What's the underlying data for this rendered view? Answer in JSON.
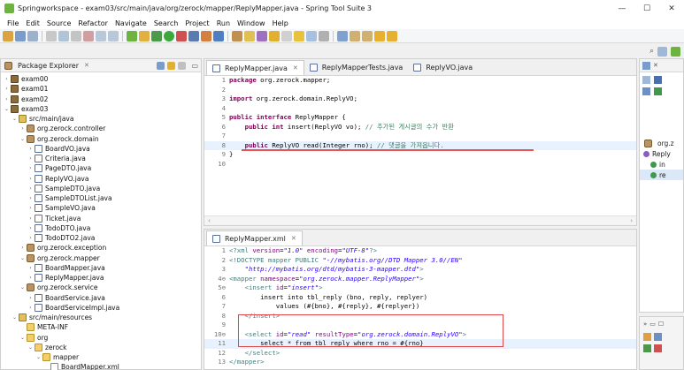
{
  "window": {
    "title": "Springworkspace - exam03/src/main/java/org/zerock/mapper/ReplyMapper.java - Spring Tool Suite 3",
    "controls": [
      "—",
      "☐",
      "✕"
    ]
  },
  "menu": [
    "File",
    "Edit",
    "Source",
    "Refactor",
    "Navigate",
    "Search",
    "Project",
    "Run",
    "Window",
    "Help"
  ],
  "package_explorer": {
    "title": "Package Explorer",
    "close_glyph": "✕",
    "items": [
      {
        "label": "exam00",
        "indent": 0,
        "icon": "project",
        "twisty": "›"
      },
      {
        "label": "exam01",
        "indent": 0,
        "icon": "project",
        "twisty": "›"
      },
      {
        "label": "exam02",
        "indent": 0,
        "icon": "project",
        "twisty": "›"
      },
      {
        "label": "exam03",
        "indent": 0,
        "icon": "project",
        "twisty": "⌄"
      },
      {
        "label": "src/main/java",
        "indent": 1,
        "icon": "srcfolder",
        "twisty": "⌄"
      },
      {
        "label": "org.zerock.controller",
        "indent": 2,
        "icon": "package",
        "twisty": "›"
      },
      {
        "label": "org.zerock.domain",
        "indent": 2,
        "icon": "package",
        "twisty": "⌄"
      },
      {
        "label": "BoardVO.java",
        "indent": 3,
        "icon": "java",
        "twisty": "›"
      },
      {
        "label": "Criteria.java",
        "indent": 3,
        "icon": "java",
        "twisty": "›"
      },
      {
        "label": "PageDTO.java",
        "indent": 3,
        "icon": "java",
        "twisty": "›"
      },
      {
        "label": "ReplyVO.java",
        "indent": 3,
        "icon": "java",
        "twisty": "›"
      },
      {
        "label": "SampleDTO.java",
        "indent": 3,
        "icon": "java",
        "twisty": "›"
      },
      {
        "label": "SampleDTOList.java",
        "indent": 3,
        "icon": "java",
        "twisty": "›"
      },
      {
        "label": "SampleVO.java",
        "indent": 3,
        "icon": "java",
        "twisty": "›"
      },
      {
        "label": "Ticket.java",
        "indent": 3,
        "icon": "java",
        "twisty": "›"
      },
      {
        "label": "TodoDTO.java",
        "indent": 3,
        "icon": "java",
        "twisty": "›"
      },
      {
        "label": "TodoDTO2.java",
        "indent": 3,
        "icon": "java",
        "twisty": "›"
      },
      {
        "label": "org.zerock.exception",
        "indent": 2,
        "icon": "package",
        "twisty": "›"
      },
      {
        "label": "org.zerock.mapper",
        "indent": 2,
        "icon": "package",
        "twisty": "⌄"
      },
      {
        "label": "BoardMapper.java",
        "indent": 3,
        "icon": "java",
        "twisty": "›"
      },
      {
        "label": "ReplyMapper.java",
        "indent": 3,
        "icon": "java",
        "twisty": "›"
      },
      {
        "label": "org.zerock.service",
        "indent": 2,
        "icon": "package",
        "twisty": "⌄"
      },
      {
        "label": "BoardService.java",
        "indent": 3,
        "icon": "java",
        "twisty": "›"
      },
      {
        "label": "BoardServiceImpl.java",
        "indent": 3,
        "icon": "java",
        "twisty": "›"
      },
      {
        "label": "src/main/resources",
        "indent": 1,
        "icon": "srcfolder",
        "twisty": "⌄"
      },
      {
        "label": "META-INF",
        "indent": 2,
        "icon": "folder",
        "twisty": ""
      },
      {
        "label": "org",
        "indent": 2,
        "icon": "folder",
        "twisty": "⌄"
      },
      {
        "label": "zerock",
        "indent": 3,
        "icon": "folder",
        "twisty": "⌄"
      },
      {
        "label": "mapper",
        "indent": 4,
        "icon": "folder",
        "twisty": "⌄"
      },
      {
        "label": "BoardMapper.xml",
        "indent": 5,
        "icon": "xml",
        "twisty": ""
      }
    ]
  },
  "editor_top": {
    "tabs": [
      {
        "label": "ReplyMapper.java",
        "active": true,
        "close": "✕"
      },
      {
        "label": "ReplyMapperTests.java",
        "active": false,
        "close": ""
      },
      {
        "label": "ReplyVO.java",
        "active": false,
        "close": ""
      }
    ],
    "lines": [
      {
        "n": "1",
        "tokens": [
          {
            "c": "kw",
            "t": "package"
          },
          {
            "c": "plain",
            "t": " org.zerock.mapper;"
          }
        ]
      },
      {
        "n": "2",
        "tokens": []
      },
      {
        "n": "3",
        "tokens": [
          {
            "c": "kw",
            "t": "import"
          },
          {
            "c": "plain",
            "t": " org.zerock.domain.ReplyVO;"
          }
        ]
      },
      {
        "n": "4",
        "tokens": []
      },
      {
        "n": "5",
        "tokens": [
          {
            "c": "kw",
            "t": "public interface"
          },
          {
            "c": "plain",
            "t": " ReplyMapper {"
          }
        ]
      },
      {
        "n": "6",
        "tokens": [
          {
            "c": "plain",
            "t": "    "
          },
          {
            "c": "kw",
            "t": "public int"
          },
          {
            "c": "plain",
            "t": " insert(ReplyVO vo); "
          },
          {
            "c": "cm",
            "t": "// 추가된 게시글의 수가 반환"
          }
        ]
      },
      {
        "n": "7",
        "tokens": []
      },
      {
        "n": "8",
        "tokens": [
          {
            "c": "plain",
            "t": "    "
          },
          {
            "c": "kw",
            "t": "public"
          },
          {
            "c": "plain",
            "t": " ReplyVO read(Integer rno); "
          },
          {
            "c": "cm",
            "t": "// 댓글을 가져옵니다."
          }
        ],
        "current": true
      },
      {
        "n": "9",
        "tokens": [
          {
            "c": "plain",
            "t": "}"
          }
        ]
      },
      {
        "n": "10",
        "tokens": []
      }
    ]
  },
  "editor_bottom": {
    "tabs": [
      {
        "label": "ReplyMapper.xml",
        "active": true,
        "close": "✕"
      }
    ],
    "lines": [
      {
        "n": "1",
        "tokens": [
          {
            "c": "tag",
            "t": "<?xml "
          },
          {
            "c": "att",
            "t": "version"
          },
          {
            "c": "plain",
            "t": "="
          },
          {
            "c": "str",
            "t": "\"1.0\""
          },
          {
            "c": "plain",
            "t": " "
          },
          {
            "c": "att",
            "t": "encoding"
          },
          {
            "c": "plain",
            "t": "="
          },
          {
            "c": "str",
            "t": "\"UTF-8\""
          },
          {
            "c": "tag",
            "t": "?>"
          }
        ]
      },
      {
        "n": "2",
        "tokens": [
          {
            "c": "tag",
            "t": "<!DOCTYPE mapper PUBLIC "
          },
          {
            "c": "str",
            "t": "\"-//mybatis.org//DTD Mapper 3.0//EN\""
          }
        ]
      },
      {
        "n": "3",
        "tokens": [
          {
            "c": "str",
            "t": "    \"http://mybatis.org/dtd/mybatis-3-mapper.dtd\""
          },
          {
            "c": "tag",
            "t": ">"
          }
        ]
      },
      {
        "n": "4⊖",
        "tokens": [
          {
            "c": "tag",
            "t": "<mapper "
          },
          {
            "c": "att",
            "t": "namespace"
          },
          {
            "c": "plain",
            "t": "="
          },
          {
            "c": "str",
            "t": "\"org.zerock.mapper.ReplyMapper\""
          },
          {
            "c": "tag",
            "t": ">"
          }
        ]
      },
      {
        "n": "5⊖",
        "tokens": [
          {
            "c": "plain",
            "t": "    "
          },
          {
            "c": "tag",
            "t": "<insert "
          },
          {
            "c": "att",
            "t": "id"
          },
          {
            "c": "plain",
            "t": "="
          },
          {
            "c": "str",
            "t": "\"insert\""
          },
          {
            "c": "tag",
            "t": ">"
          }
        ]
      },
      {
        "n": "6",
        "tokens": [
          {
            "c": "plain",
            "t": "        insert into tbl_reply (bno, reply, replyer)"
          }
        ]
      },
      {
        "n": "7",
        "tokens": [
          {
            "c": "plain",
            "t": "            values (#{bno}, #{reply}, #{replyer})"
          }
        ]
      },
      {
        "n": "8",
        "tokens": [
          {
            "c": "plain",
            "t": "    "
          },
          {
            "c": "tag",
            "t": "</insert>"
          }
        ]
      },
      {
        "n": "9",
        "tokens": []
      },
      {
        "n": "10⊖",
        "tokens": [
          {
            "c": "plain",
            "t": "    "
          },
          {
            "c": "tag",
            "t": "<select "
          },
          {
            "c": "att",
            "t": "id"
          },
          {
            "c": "plain",
            "t": "="
          },
          {
            "c": "str",
            "t": "\"read\""
          },
          {
            "c": "plain",
            "t": " "
          },
          {
            "c": "att",
            "t": "resultType"
          },
          {
            "c": "plain",
            "t": "="
          },
          {
            "c": "str",
            "t": "\"org.zerock.domain.ReplyVO\""
          },
          {
            "c": "tag",
            "t": ">"
          }
        ]
      },
      {
        "n": "11",
        "tokens": [
          {
            "c": "plain",
            "t": "        select * from tbl_reply where rno = #{rno}"
          }
        ],
        "current": true
      },
      {
        "n": "12",
        "tokens": [
          {
            "c": "plain",
            "t": "    "
          },
          {
            "c": "tag",
            "t": "</select>"
          }
        ]
      },
      {
        "n": "13",
        "tokens": [
          {
            "c": "tag",
            "t": "</mapper>"
          }
        ]
      }
    ]
  },
  "outline": {
    "items": [
      "org.z",
      "Reply",
      "in",
      "re"
    ]
  },
  "colors": {
    "keyword": "#7f0055",
    "comment": "#3f7f5f",
    "string": "#2a00ff",
    "annotation_red": "#e04848"
  }
}
